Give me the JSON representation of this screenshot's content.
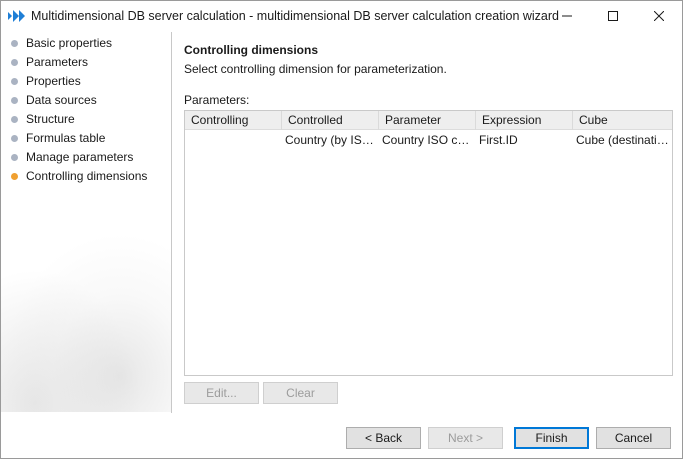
{
  "window": {
    "title": "Multidimensional DB server calculation - multidimensional DB server calculation creation wizard"
  },
  "sidebar": {
    "items": [
      {
        "label": "Basic properties"
      },
      {
        "label": "Parameters"
      },
      {
        "label": "Properties"
      },
      {
        "label": "Data sources"
      },
      {
        "label": "Structure"
      },
      {
        "label": "Formulas table"
      },
      {
        "label": "Manage parameters"
      },
      {
        "label": "Controlling dimensions",
        "active": true
      }
    ],
    "dot_color": "#aab3c2",
    "active_dot_color": "#f0a030"
  },
  "main": {
    "heading": "Controlling dimensions",
    "subheading": "Select controlling dimension for parameterization.",
    "params_label": "Parameters:",
    "table": {
      "columns": [
        "Controlling",
        "Controlled",
        "Parameter",
        "Expression",
        "Cube"
      ],
      "rows": [
        [
          "",
          "Country (by ISO…",
          "Country ISO code",
          "First.ID",
          "Cube (destinatio…"
        ]
      ]
    },
    "edit_label": "Edit...",
    "clear_label": "Clear"
  },
  "footer": {
    "back_label": "< Back",
    "next_label": "Next >",
    "finish_label": "Finish",
    "cancel_label": "Cancel"
  },
  "icons": {
    "app": "play-arrows-icon",
    "minimize": "minimize-icon",
    "maximize": "maximize-icon",
    "close": "close-icon"
  },
  "colors": {
    "accent": "#0078d7",
    "app_icon": "#1f7fd6"
  }
}
